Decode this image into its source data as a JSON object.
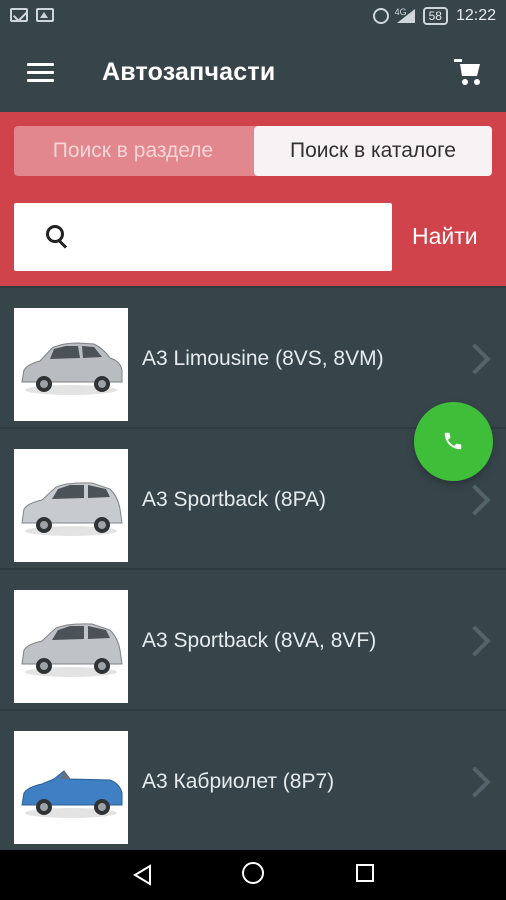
{
  "status_bar": {
    "time": "12:22",
    "battery": "58",
    "network": "4G"
  },
  "toolbar": {
    "title": "Автозапчасти"
  },
  "search_tabs": [
    {
      "label": "Поиск в разделе",
      "active": false
    },
    {
      "label": "Поиск в каталоге",
      "active": true
    }
  ],
  "search": {
    "value": "",
    "placeholder": "",
    "button_label": "Найти"
  },
  "models": [
    {
      "label": "A3 Limousine (8VS, 8VM)",
      "car_color": "#b9bdc2"
    },
    {
      "label": "A3 Sportback (8PA)",
      "car_color": "#c7cbcf"
    },
    {
      "label": "A3 Sportback (8VA, 8VF)",
      "car_color": "#bfc3c7"
    },
    {
      "label": "A3 Кабриолет (8P7)",
      "car_color": "#3f7fc4"
    }
  ],
  "colors": {
    "toolbar": "#37454b",
    "accent_red": "#d0434b",
    "call_green": "#3fbe3a"
  }
}
